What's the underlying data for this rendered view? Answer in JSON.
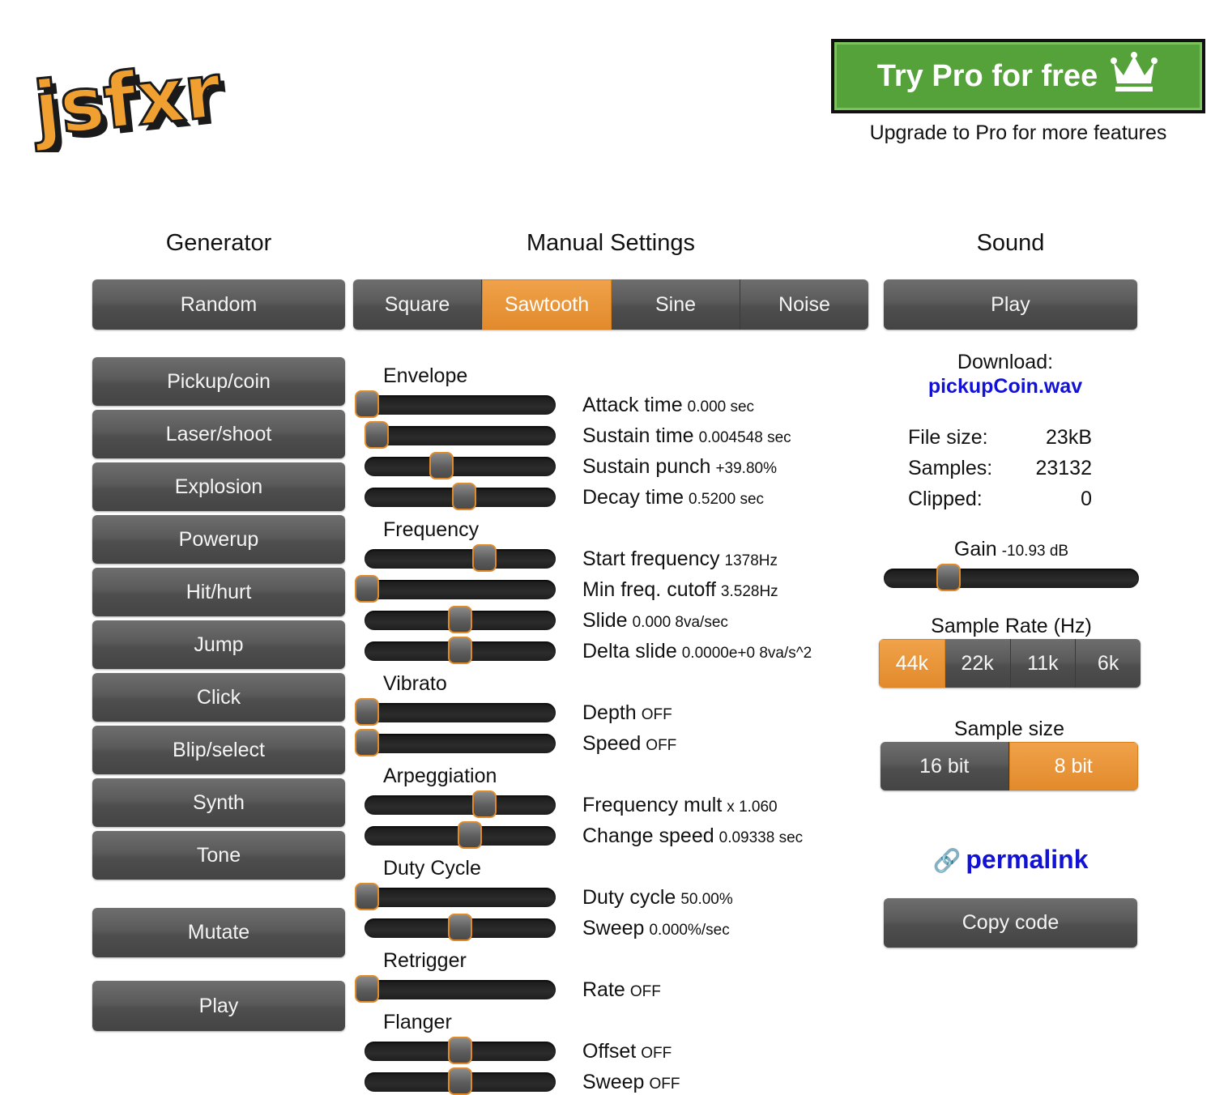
{
  "logo": {
    "text": "jsfxr"
  },
  "pro": {
    "button_label": "Try Pro for free",
    "subtitle": "Upgrade to Pro for more features"
  },
  "columns": {
    "generator": "Generator",
    "manual": "Manual Settings",
    "sound": "Sound"
  },
  "generator": {
    "random": "Random",
    "presets": [
      "Pickup/coin",
      "Laser/shoot",
      "Explosion",
      "Powerup",
      "Hit/hurt",
      "Jump",
      "Click",
      "Blip/select",
      "Synth",
      "Tone"
    ],
    "mutate": "Mutate",
    "play": "Play"
  },
  "waveforms": {
    "items": [
      "Square",
      "Sawtooth",
      "Sine",
      "Noise"
    ],
    "selected": "Sawtooth"
  },
  "groups": {
    "envelope": "Envelope",
    "frequency": "Frequency",
    "vibrato": "Vibrato",
    "arpeggiation": "Arpeggiation",
    "duty": "Duty Cycle",
    "retrigger": "Retrigger",
    "flanger": "Flanger"
  },
  "params": [
    {
      "label": "Attack time",
      "value": "0.000 sec",
      "level": 0.0
    },
    {
      "label": "Sustain time",
      "value": "0.004548 sec",
      "level": 0.05
    },
    {
      "label": "Sustain punch",
      "value": "+39.80%",
      "level": 0.4
    },
    {
      "label": "Decay time",
      "value": "0.5200 sec",
      "level": 0.52
    },
    {
      "label": "Start frequency",
      "value": "1378Hz",
      "level": 0.63
    },
    {
      "label": "Min freq. cutoff",
      "value": "3.528Hz",
      "level": 0.0
    },
    {
      "label": "Slide",
      "value": "0.000 8va/sec",
      "level": 0.5
    },
    {
      "label": "Delta slide",
      "value": "0.0000e+0 8va/s^2",
      "level": 0.5
    },
    {
      "label": "Depth",
      "value": "OFF",
      "level": 0.0
    },
    {
      "label": "Speed",
      "value": "OFF",
      "level": 0.0
    },
    {
      "label": "Frequency mult",
      "value": "x 1.060",
      "level": 0.63
    },
    {
      "label": "Change speed",
      "value": "0.09338 sec",
      "level": 0.55
    },
    {
      "label": "Duty cycle",
      "value": "50.00%",
      "level": 0.0
    },
    {
      "label": "Sweep",
      "value": "0.000%/sec",
      "level": 0.5
    },
    {
      "label": "Rate",
      "value": "OFF",
      "level": 0.0
    },
    {
      "label": "Offset",
      "value": "OFF",
      "level": 0.5
    },
    {
      "label": "Sweep",
      "value": "OFF",
      "level": 0.5
    }
  ],
  "sound": {
    "play": "Play",
    "download_label": "Download:",
    "download_file": "pickupCoin.wav",
    "file_size_label": "File size:",
    "file_size": "23kB",
    "samples_label": "Samples:",
    "samples": "23132",
    "clipped_label": "Clipped:",
    "clipped": "0",
    "gain_label": "Gain",
    "gain_value": "-10.93 dB",
    "gain_level": 0.25,
    "sample_rate_label": "Sample Rate (Hz)",
    "sample_rates": [
      "44k",
      "22k",
      "11k",
      "6k"
    ],
    "sample_rate_selected": "44k",
    "sample_size_label": "Sample size",
    "sample_sizes": [
      "16 bit",
      "8 bit"
    ],
    "sample_size_selected": "8 bit",
    "permalink": "permalink",
    "copy_code": "Copy code"
  },
  "colors": {
    "accent": "#e8902f",
    "pro_green": "#56a23a",
    "link": "#1212d6"
  }
}
